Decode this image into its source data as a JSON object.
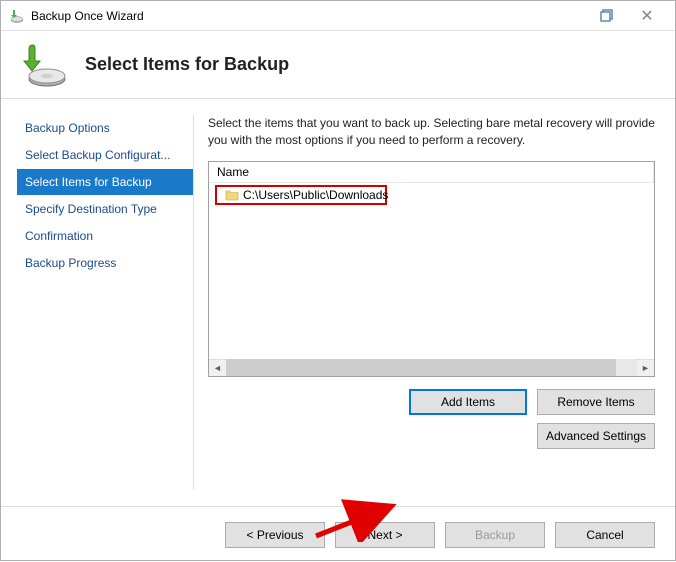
{
  "window": {
    "title": "Backup Once Wizard"
  },
  "header": {
    "page_title": "Select Items for Backup"
  },
  "sidebar": {
    "steps": [
      {
        "label": "Backup Options",
        "active": false
      },
      {
        "label": "Select Backup Configurat...",
        "active": false
      },
      {
        "label": "Select Items for Backup",
        "active": true
      },
      {
        "label": "Specify Destination Type",
        "active": false
      },
      {
        "label": "Confirmation",
        "active": false
      },
      {
        "label": "Backup Progress",
        "active": false
      }
    ]
  },
  "main": {
    "instructions": "Select the items that you want to back up. Selecting bare metal recovery will provide you with the most options if you need to perform a recovery.",
    "list": {
      "column_header": "Name",
      "items": [
        {
          "path": "C:\\Users\\Public\\Downloads"
        }
      ]
    },
    "buttons": {
      "add_items": "Add Items",
      "remove_items": "Remove Items",
      "advanced_settings": "Advanced Settings"
    }
  },
  "footer": {
    "previous": "< Previous",
    "next": "Next >",
    "backup": "Backup",
    "cancel": "Cancel"
  }
}
